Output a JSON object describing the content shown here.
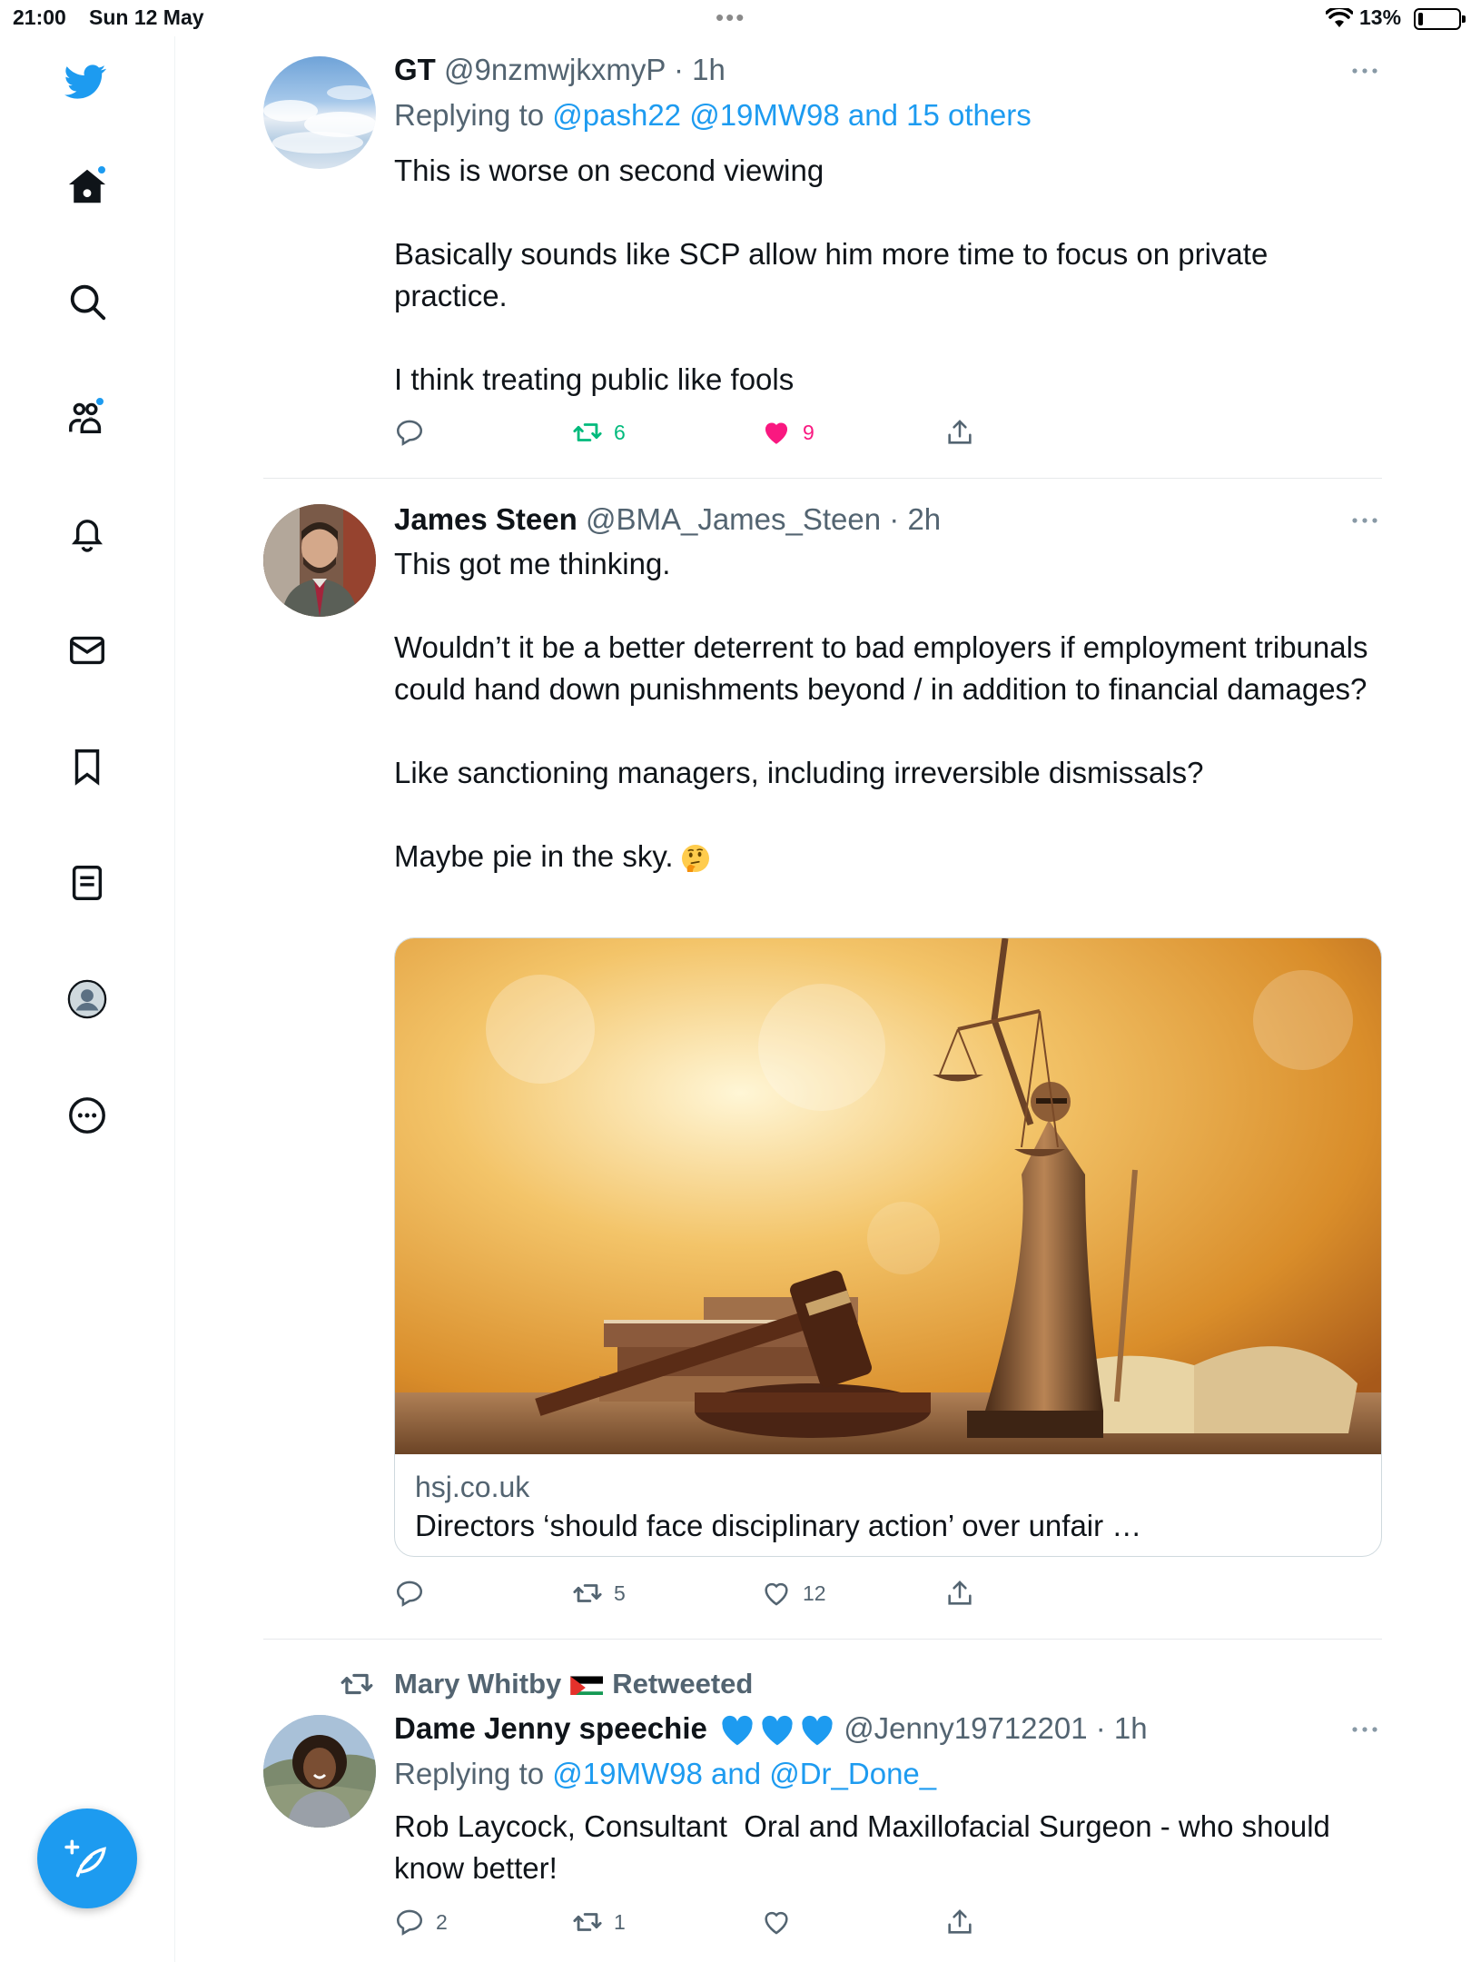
{
  "status_bar": {
    "time": "21:00",
    "date": "Sun 12 May",
    "dots": "•••",
    "battery_pct": "13%",
    "battery_level": 0.13
  },
  "sidebar": {
    "items": [
      {
        "name": "home",
        "icon": "home-icon",
        "badge": true
      },
      {
        "name": "explore",
        "icon": "search-icon",
        "badge": false
      },
      {
        "name": "communities",
        "icon": "communities-icon",
        "badge": true
      },
      {
        "name": "notifications",
        "icon": "bell-icon",
        "badge": false
      },
      {
        "name": "messages",
        "icon": "mail-icon",
        "badge": false
      },
      {
        "name": "bookmarks",
        "icon": "bookmark-icon",
        "badge": false
      },
      {
        "name": "lists",
        "icon": "list-icon",
        "badge": false
      },
      {
        "name": "profile",
        "icon": "profile-icon",
        "badge": false
      },
      {
        "name": "more",
        "icon": "more-circle-icon",
        "badge": false
      }
    ],
    "compose_icon": "compose-feather-icon"
  },
  "colors": {
    "accent": "#1d9bf0",
    "retweet": "#00ba7c",
    "like": "#f91880",
    "secondary_text": "#536471"
  },
  "tweets": [
    {
      "name": "GT",
      "handle": "@9nzmwjkxmyP",
      "time": "· 1h",
      "replying_prefix": "Replying to ",
      "replying_to": "@pash22 @19MW98 and 15 others",
      "text": "This is worse on second viewing\n\nBasically sounds like SCP allow him more time to focus on private practice.\n\nI think treating public like fools",
      "retweets": "6",
      "likes": "9",
      "retweeted": true,
      "liked": true
    },
    {
      "name": "James Steen",
      "handle": "@BMA_James_Steen",
      "time": "· 2h",
      "text": "This got me thinking.\n\nWouldn’t it be a better deterrent to bad employers if employment tribunals could hand down punishments beyond / in addition to financial damages?\n\nLike sanctioning managers, including irreversible dismissals?\n\nMaybe pie in the sky.",
      "emoji": "thinking-face-icon",
      "card": {
        "domain": "hsj.co.uk",
        "title": "Directors ‘should face disciplinary action’ over unfair …",
        "image": "lady-justice-statue-gavel-books"
      },
      "retweets": "5",
      "likes": "12"
    },
    {
      "retweeted_by": "Mary Whitby",
      "retweeted_label": "Retweeted",
      "name": "Dame Jenny speechie",
      "handle": "@Jenny19712201",
      "time": "· 1h",
      "replying_prefix": "Replying to ",
      "replying_to": "@19MW98 and @Dr_Done_",
      "text": "Rob Laycock, Consultant  Oral and Maxillofacial Surgeon - who should know better!",
      "replies": "2",
      "retweets": "1"
    }
  ]
}
